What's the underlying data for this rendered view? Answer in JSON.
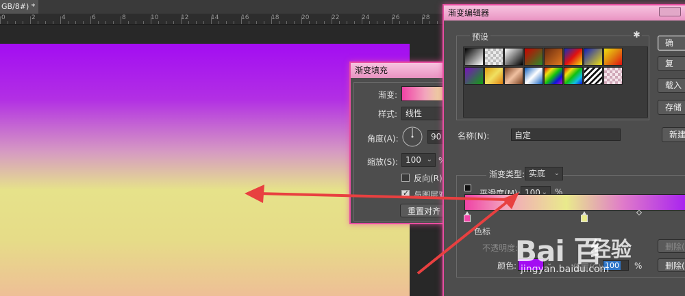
{
  "document": {
    "tab_title": "GB/8#) *",
    "close": "×",
    "ruler_labels": [
      "0",
      "2",
      "4",
      "6",
      "8",
      "10",
      "12",
      "14",
      "16",
      "18",
      "20",
      "22",
      "24",
      "26",
      "28",
      "30"
    ]
  },
  "gradient_fill": {
    "title": "渐变填充",
    "gradient_label": "渐变:",
    "style_label": "样式:",
    "style_value": "线性",
    "angle_label": "角度(A):",
    "angle_value": "90",
    "scale_label": "缩放(S):",
    "scale_value": "100",
    "scale_unit": "%",
    "reverse_label": "反向(R)",
    "align_label": "与图层对",
    "reset_button": "重置对齐"
  },
  "gradient_editor": {
    "title": "渐变编辑器",
    "presets_label": "预设",
    "buttons": [
      "确",
      "复",
      "载入",
      "存储"
    ],
    "name_label": "名称(N):",
    "name_value": "自定",
    "new_button": "新建",
    "type_label": "渐变类型:",
    "type_value": "实底",
    "smoothness_label": "平滑度(M):",
    "smoothness_value": "100",
    "smoothness_unit": "%",
    "stops_label": "色标",
    "opacity_label": "不透明度:",
    "delete_label": "删除(D",
    "color_label": "颜色:",
    "position_label": "位置(C):",
    "position_value": "100",
    "position_unit": "%",
    "delete_label_2": "删除(D",
    "colors": {
      "stop_start": "#f043a6",
      "stop_mid": "#e9ea8c",
      "stop_end": "#a30df2"
    }
  },
  "watermark": {
    "logo": "Bai 百",
    "jingyan": "经验",
    "url": "jingyan.baidu.com"
  }
}
